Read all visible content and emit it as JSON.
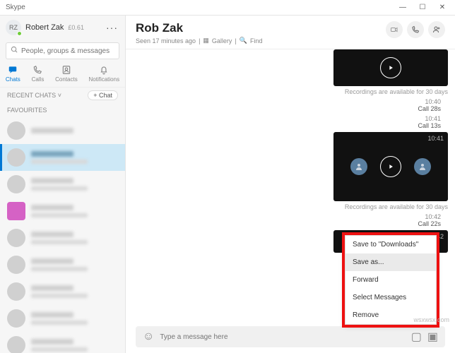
{
  "window": {
    "title": "Skype",
    "min": "—",
    "max": "☐",
    "close": "✕"
  },
  "user": {
    "initials": "RZ",
    "name": "Robert Zak",
    "balance": "£0.61",
    "more": "···"
  },
  "search": {
    "placeholder": "People, groups & messages"
  },
  "tabs": [
    {
      "label": "Chats",
      "active": true
    },
    {
      "label": "Calls",
      "active": false
    },
    {
      "label": "Contacts",
      "active": false
    },
    {
      "label": "Notifications",
      "active": false
    }
  ],
  "sidebar": {
    "recent": "RECENT CHATS",
    "fav": "FAVOURITES",
    "chatBtn": "+ Chat"
  },
  "chat": {
    "title": "Rob Zak",
    "seen": "Seen 17 minutes ago",
    "gallery": "Gallery",
    "find": "Find",
    "caption": "Recordings are available for 30 days"
  },
  "calls": [
    {
      "time": "10:40",
      "desc": "Call 28s"
    },
    {
      "time": "10:41",
      "desc": "Call 13s"
    },
    {
      "time": "10:42",
      "desc": "Call 22s"
    }
  ],
  "badges": {
    "v2": "10:41",
    "v3": "10:42"
  },
  "menu": [
    "Save to \"Downloads\"",
    "Save as...",
    "Forward",
    "Select Messages",
    "Remove"
  ],
  "composer": {
    "placeholder": "Type a message here"
  },
  "watermark": "wsxwsx.com"
}
